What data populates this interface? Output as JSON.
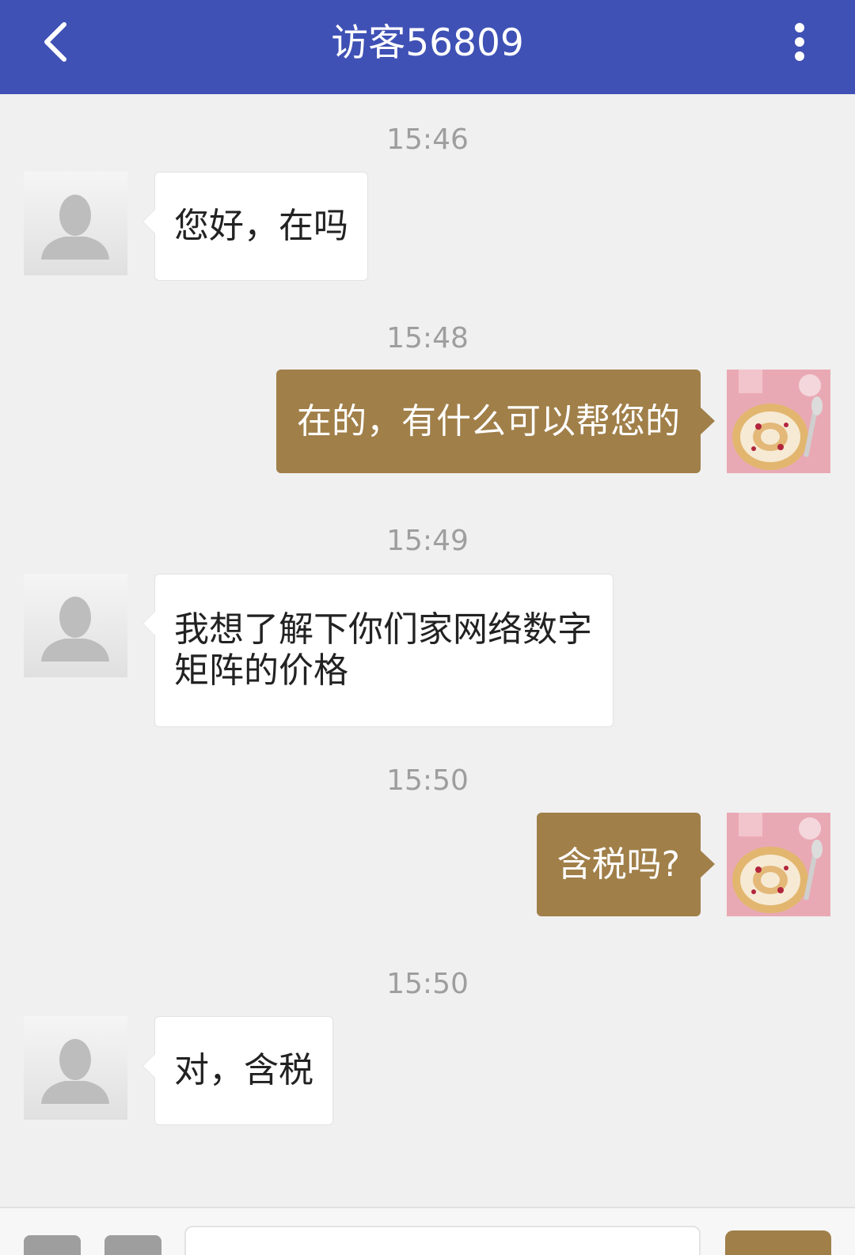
{
  "header": {
    "title": "访客56809",
    "back_icon": "chevron-left-icon",
    "more_icon": "more-vertical-icon",
    "background_color": "#3f51b5"
  },
  "messages": [
    {
      "time": "15:46",
      "sender": "visitor",
      "text": "您好，在吗"
    },
    {
      "time": "15:48",
      "sender": "agent",
      "text": "在的，有什么可以帮您的"
    },
    {
      "time": "15:49",
      "sender": "visitor",
      "text": "我想了解下你们家网络数字矩阵的价格"
    },
    {
      "time": "15:50",
      "sender": "agent",
      "text": "含税吗?"
    },
    {
      "time": "15:50",
      "sender": "visitor",
      "text": "对，含税"
    }
  ],
  "colors": {
    "agent_bubble": "#a07f49",
    "visitor_bubble": "#ffffff",
    "background": "#f0f0f0"
  }
}
